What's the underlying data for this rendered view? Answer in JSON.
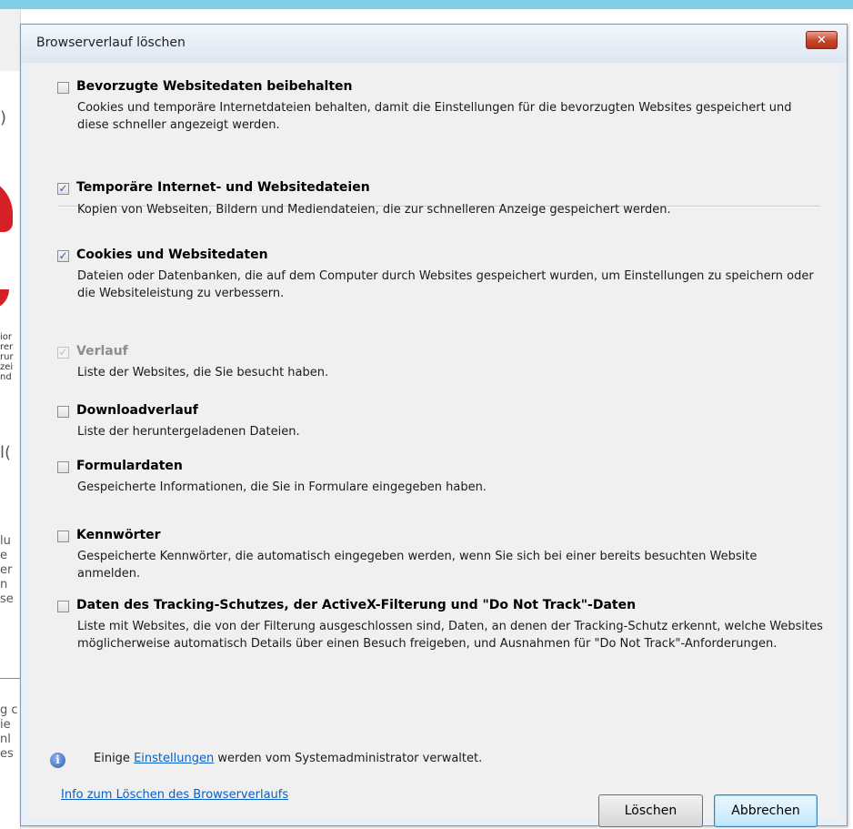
{
  "dialog": {
    "title": "Browserverlauf löschen",
    "close_label": "✕"
  },
  "options": [
    {
      "title": "Bevorzugte Websitedaten beibehalten",
      "checked": false,
      "disabled": false,
      "description": "Cookies und temporäre Internetdateien behalten, damit die Einstellungen für die bevorzugten Websites gespeichert und diese schneller angezeigt werden."
    },
    {
      "title": "Temporäre Internet- und Websitedateien",
      "checked": true,
      "disabled": false,
      "description": "Kopien von Webseiten, Bildern und Mediendateien, die zur schnelleren Anzeige gespeichert werden."
    },
    {
      "title": "Cookies und Websitedaten",
      "checked": true,
      "disabled": false,
      "description": "Dateien oder Datenbanken, die auf dem Computer durch Websites gespeichert wurden, um Einstellungen zu speichern oder die Websiteleistung zu verbessern."
    },
    {
      "title": "Verlauf",
      "checked": true,
      "disabled": true,
      "description": "Liste der Websites, die Sie besucht haben."
    },
    {
      "title": "Downloadverlauf",
      "checked": false,
      "disabled": false,
      "description": "Liste der heruntergeladenen Dateien."
    },
    {
      "title": "Formulardaten",
      "checked": false,
      "disabled": false,
      "description": "Gespeicherte Informationen, die Sie in Formulare eingegeben haben."
    },
    {
      "title": "Kennwörter",
      "checked": false,
      "disabled": false,
      "description": "Gespeicherte Kennwörter, die automatisch eingegeben werden, wenn Sie sich bei einer bereits besuchten Website anmelden."
    },
    {
      "title": "Daten des Tracking-Schutzes, der ActiveX-Filterung und \"Do Not Track\"-Daten",
      "checked": false,
      "disabled": false,
      "description": "Liste mit Websites, die von der Filterung ausgeschlossen sind, Daten, an denen der Tracking-Schutz erkennt, welche Websites möglicherweise automatisch Details über einen Besuch freigeben, und Ausnahmen für \"Do Not Track\"-Anforderungen."
    }
  ],
  "info": {
    "prefix": "Einige ",
    "link": "Einstellungen",
    "suffix": " werden vom Systemadministrator verwaltet."
  },
  "help_link": "Info zum Löschen des Browserverlaufs",
  "buttons": {
    "delete": "Löschen",
    "cancel": "Abbrechen"
  },
  "check_glyph": "✓",
  "background_fragments": {
    "top_glyph": ")",
    "block1": "ior\nrer\nrur\nzei\nnd",
    "glyph2": "l(",
    "block2": "lu\ne\ner\nn\nse",
    "block3": "g c\nie\nnl\nes"
  }
}
